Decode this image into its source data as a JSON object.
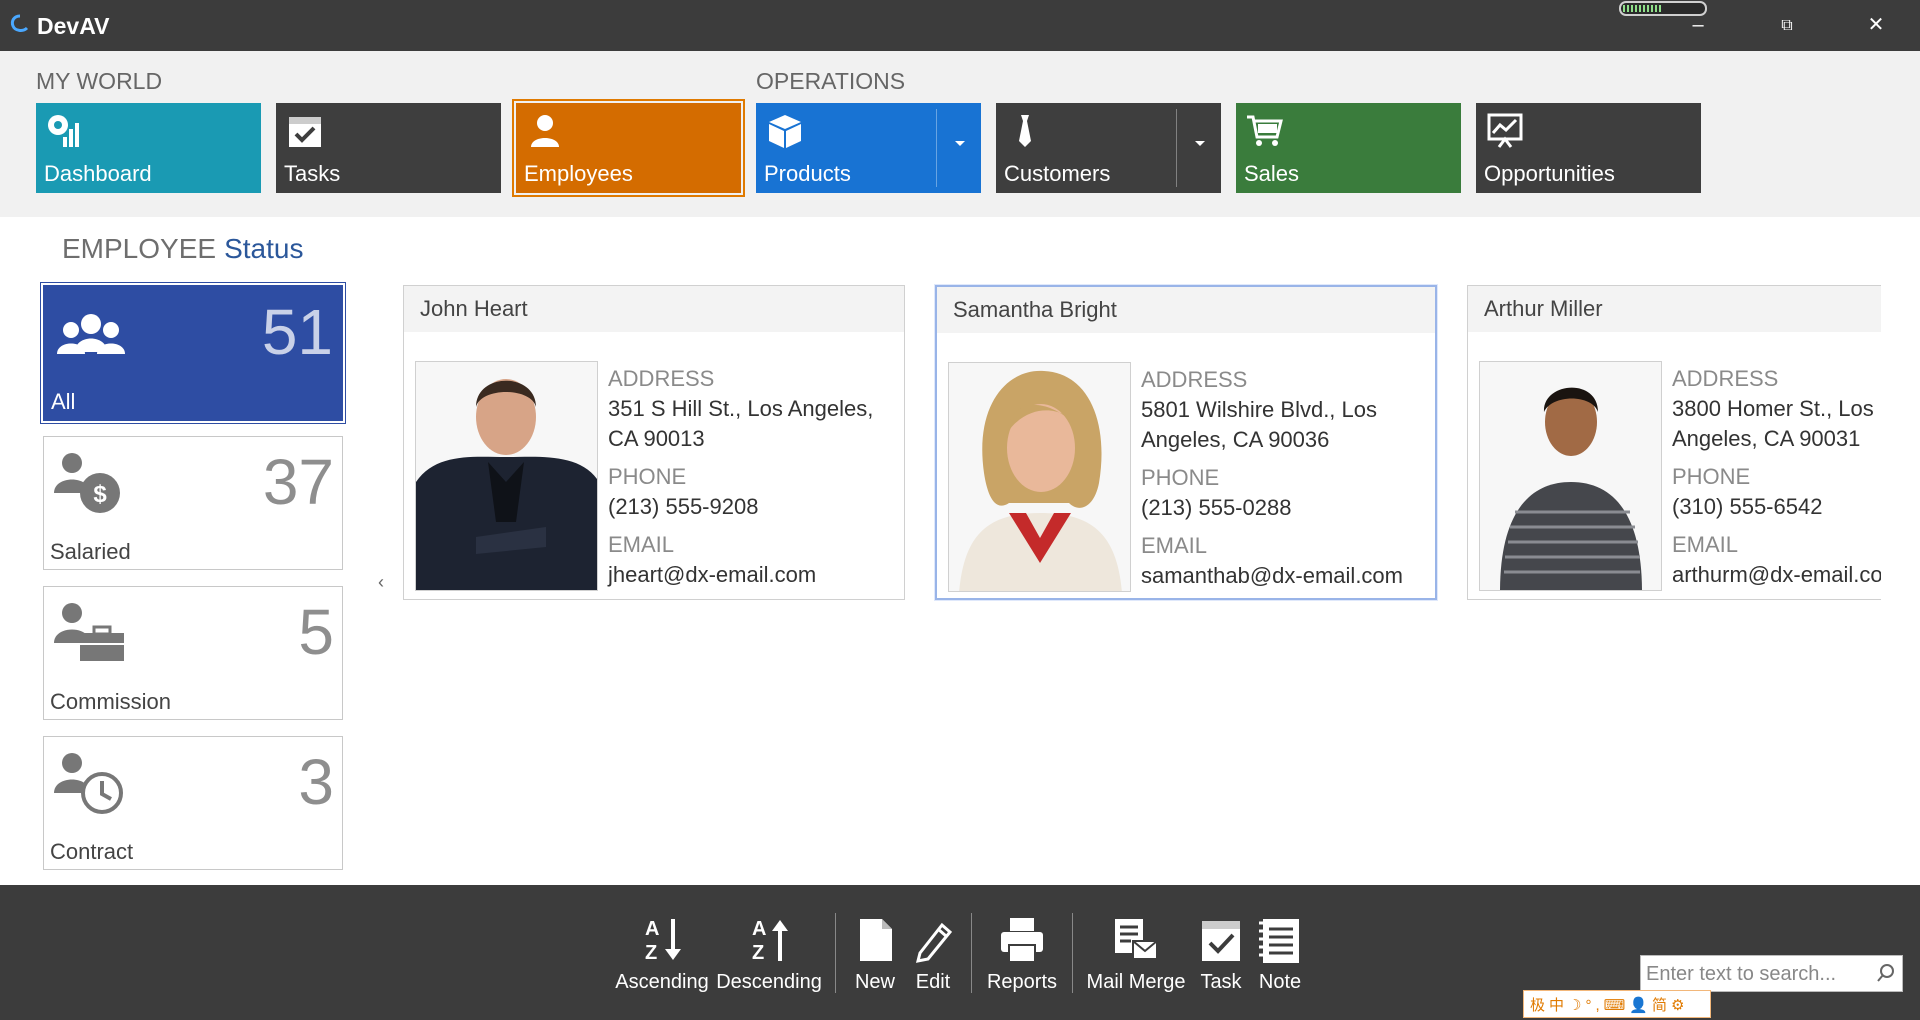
{
  "app": {
    "title": "DevAV"
  },
  "window": {
    "minimize": "–",
    "maximize": "⧉",
    "close": "✕"
  },
  "nav": {
    "groups": [
      {
        "label": "MY WORLD"
      },
      {
        "label": "OPERATIONS"
      }
    ],
    "tiles": [
      {
        "label": "Dashboard",
        "icon": "dashboard-icon",
        "color": "#1a9ab3"
      },
      {
        "label": "Tasks",
        "icon": "calendar-check-icon",
        "color": "#3e3e3e"
      },
      {
        "label": "Employees",
        "icon": "person-icon",
        "color": "#d46c00"
      },
      {
        "label": "Products",
        "icon": "box-icon",
        "color": "#1873d3"
      },
      {
        "label": "Customers",
        "icon": "tie-icon",
        "color": "#3e3e3e"
      },
      {
        "label": "Sales",
        "icon": "cart-icon",
        "color": "#3a7c3c"
      },
      {
        "label": "Opportunities",
        "icon": "presentation-icon",
        "color": "#3e3e3e"
      }
    ]
  },
  "page": {
    "title_a": "EMPLOYEE",
    "title_b": "Status"
  },
  "status": [
    {
      "label": "All",
      "count": "51",
      "icon": "group-icon"
    },
    {
      "label": "Salaried",
      "count": "37",
      "icon": "salaried-icon"
    },
    {
      "label": "Commission",
      "count": "5",
      "icon": "briefcase-icon"
    },
    {
      "label": "Contract",
      "count": "3",
      "icon": "clock-icon"
    }
  ],
  "employees": [
    {
      "name": "John Heart",
      "address_label": "ADDRESS",
      "address": "351 S Hill St., Los Angeles, CA 90013",
      "phone_label": "PHONE",
      "phone": "(213) 555-9208",
      "email_label": "EMAIL",
      "email": "jheart@dx-email.com"
    },
    {
      "name": "Samantha Bright",
      "address_label": "ADDRESS",
      "address": "5801 Wilshire Blvd., Los Angeles, CA 90036",
      "phone_label": "PHONE",
      "phone": "(213) 555-0288",
      "email_label": "EMAIL",
      "email": "samanthab@dx-email.com"
    },
    {
      "name": "Arthur Miller",
      "address_label": "ADDRESS",
      "address": "3800 Homer St., Los Angeles, CA 90031",
      "phone_label": "PHONE",
      "phone": "(310) 555-6542",
      "email_label": "EMAIL",
      "email": "arthurm@dx-email.com"
    }
  ],
  "pager": {
    "prev": "‹"
  },
  "toolbar": {
    "ascending": "Ascending",
    "descending": "Descending",
    "new": "New",
    "edit": "Edit",
    "reports": "Reports",
    "mail_merge": "Mail Merge",
    "task": "Task",
    "note": "Note",
    "search_placeholder": "Enter text to search..."
  },
  "ime": {
    "text": "极中☽°,⌨👤简⚙"
  }
}
